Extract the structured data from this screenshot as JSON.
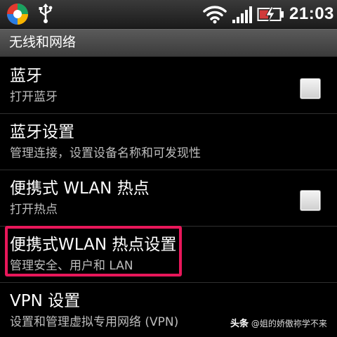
{
  "status_bar": {
    "time": "21:03",
    "icons": [
      "app-launcher-icon",
      "usb-icon",
      "wifi-icon",
      "signal-icon",
      "battery-charging-icon"
    ]
  },
  "section": {
    "title": "无线和网络"
  },
  "items": [
    {
      "title": "蓝牙",
      "subtitle": "打开蓝牙",
      "checkbox": true,
      "checked": false
    },
    {
      "title": "蓝牙设置",
      "subtitle": "管理连接，设置设备名称和可发现性",
      "checkbox": false
    },
    {
      "title": "便携式 WLAN 热点",
      "subtitle": "打开热点",
      "checkbox": true,
      "checked": false
    },
    {
      "title": "便携式WLAN 热点设置",
      "subtitle": "管理安全、用户和 LAN",
      "checkbox": false,
      "highlighted": true
    },
    {
      "title": "VPN 设置",
      "subtitle": "设置和管理虚拟专用网络 (VPN)",
      "checkbox": false
    }
  ],
  "watermark": {
    "brand": "头条",
    "author": "@姐的娇傲祢学不来"
  },
  "colors": {
    "highlight": "#e8175a",
    "background": "#000000",
    "subtitle": "#bdbdbd"
  }
}
